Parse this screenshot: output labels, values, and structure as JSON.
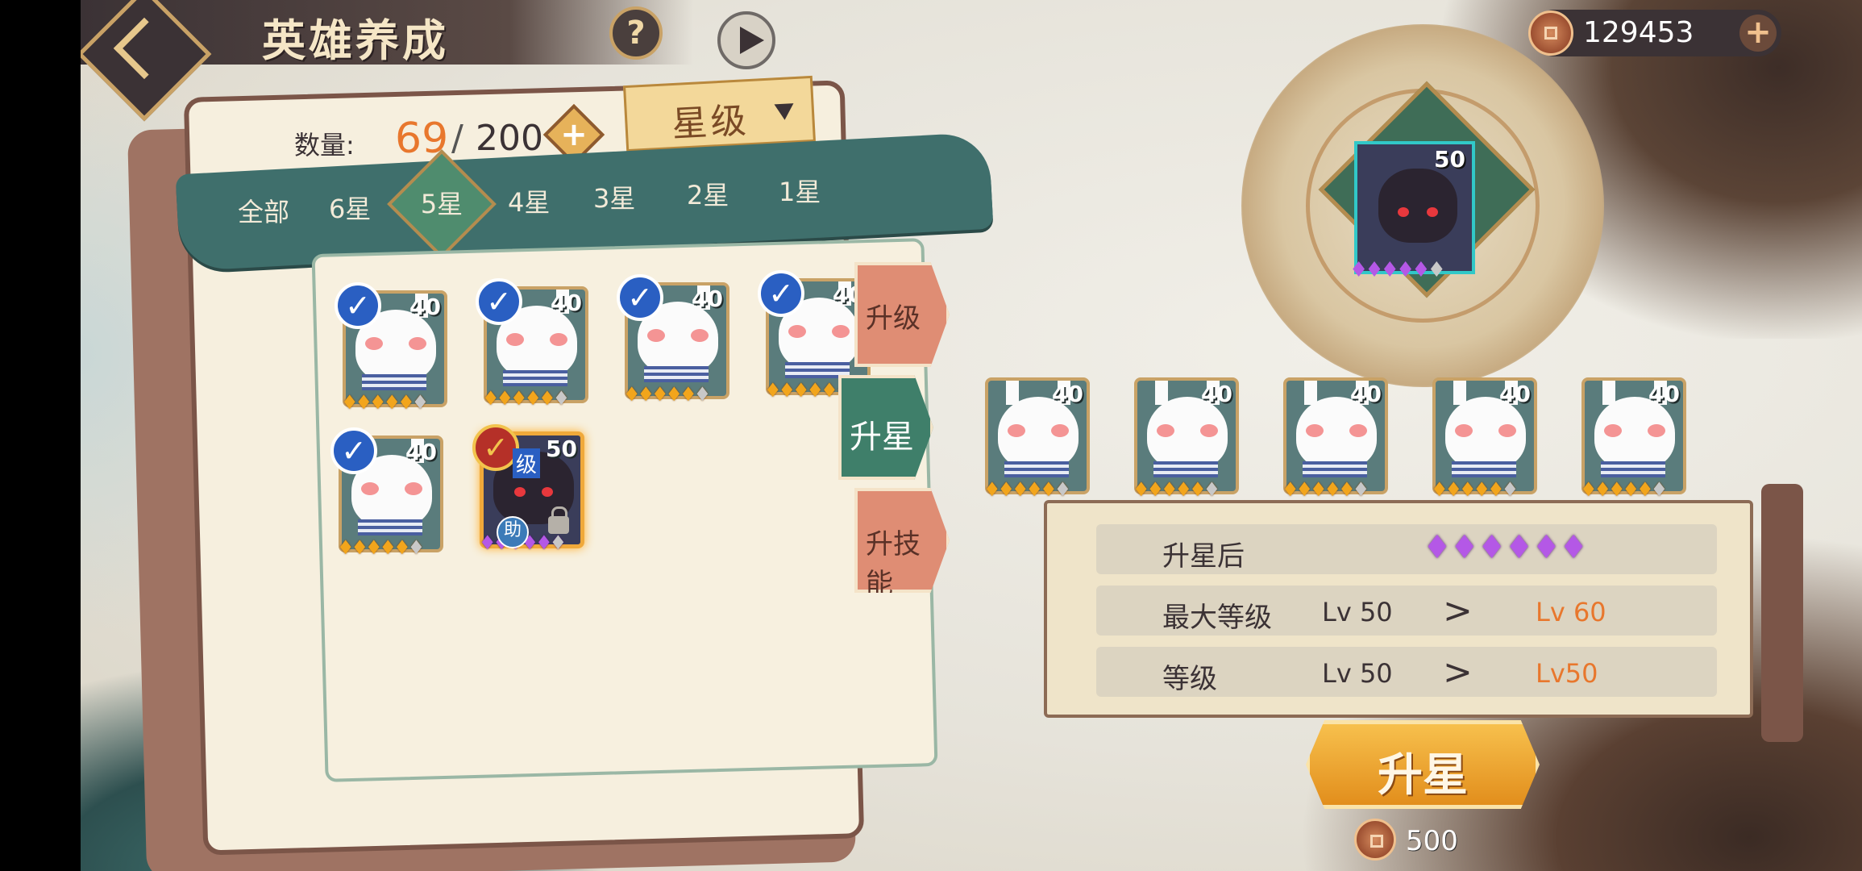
{
  "header": {
    "title": "英雄养成",
    "help_label": "?"
  },
  "currency": {
    "value": "129453",
    "plus": "+"
  },
  "inventory": {
    "qty_label": "数量:",
    "qty_value": "69",
    "qty_sep": "/",
    "qty_max": "200",
    "plus": "+",
    "sort_label": "星级"
  },
  "tabs": [
    "全部",
    "6星",
    "5星",
    "4星",
    "3星",
    "2星",
    "1星"
  ],
  "active_tab": "5星",
  "side_tabs": [
    "升级",
    "升星",
    "升技能"
  ],
  "active_side_tab": "升星",
  "hero_cards": [
    {
      "level": "40",
      "stars": 5,
      "max_stars": 6,
      "star_icon": "flame-icon",
      "checked": true
    },
    {
      "level": "40",
      "stars": 5,
      "max_stars": 6,
      "star_icon": "flame-icon",
      "checked": true
    },
    {
      "level": "40",
      "stars": 5,
      "max_stars": 6,
      "star_icon": "flame-icon",
      "checked": true
    },
    {
      "level": "40",
      "stars": 5,
      "max_stars": 6,
      "star_icon": "flame-icon",
      "checked": true
    },
    {
      "level": "40",
      "stars": 5,
      "max_stars": 6,
      "star_icon": "flame-icon",
      "checked": true
    },
    {
      "level": "50",
      "stars": 5,
      "max_stars": 6,
      "star_icon": "purple-flame-icon",
      "checked": true,
      "tag": "级",
      "assist": "助",
      "locked": true
    }
  ],
  "target_hero": {
    "level": "50",
    "stars": 5,
    "max_stars": 6
  },
  "material_cards": [
    {
      "level": "40",
      "stars": 5,
      "max_stars": 6
    },
    {
      "level": "40",
      "stars": 5,
      "max_stars": 6
    },
    {
      "level": "40",
      "stars": 5,
      "max_stars": 6
    },
    {
      "level": "40",
      "stars": 5,
      "max_stars": 6
    },
    {
      "level": "40",
      "stars": 5,
      "max_stars": 6
    }
  ],
  "upgrade_info": {
    "after_label": "升星后",
    "after_stars": 6,
    "max_level_label": "最大等级",
    "max_level_from": "Lv 50",
    "max_level_to": "Lv 60",
    "level_label": "等级",
    "level_from": "Lv 50",
    "level_to": "Lv50",
    "arrow": ">"
  },
  "action": {
    "label": "升星",
    "cost": "500"
  },
  "colors": {
    "accent": "#e8772d",
    "teal": "#3f6f6c",
    "gold": "#f0a93a",
    "purple": "#b458e6"
  }
}
